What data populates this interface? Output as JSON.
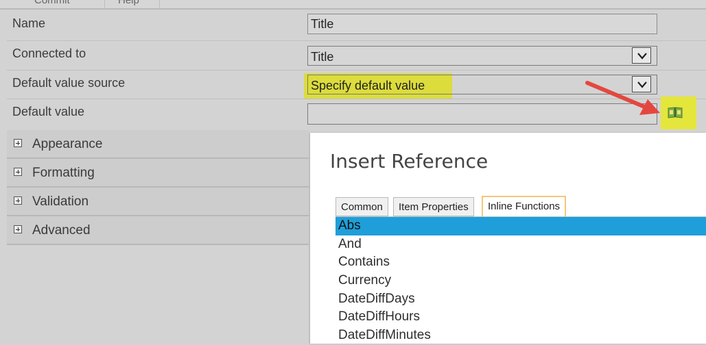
{
  "top_tabs": {
    "commit": "Commit",
    "help": "Help"
  },
  "properties": {
    "name_label": "Name",
    "name_value": "Title",
    "connected_label": "Connected to",
    "connected_value": "Title",
    "dvs_label": "Default value source",
    "dvs_value": "Specify default value",
    "dv_label": "Default value",
    "dv_value": ""
  },
  "sections": [
    "Appearance",
    "Formatting",
    "Validation",
    "Advanced"
  ],
  "dialog": {
    "title": "Insert Reference",
    "tabs": [
      "Common",
      "Item Properties",
      "Inline Functions"
    ],
    "active_tab": "Inline Functions",
    "items": [
      "Abs",
      "And",
      "Contains",
      "Currency",
      "DateDiffDays",
      "DateDiffHours",
      "DateDiffMinutes"
    ],
    "selected_item": "Abs"
  },
  "colors": {
    "highlight": "#dcdc3c",
    "selection": "#1e9fd9",
    "arrow": "#e4473f",
    "active_tab_border": "#f2c879"
  },
  "icons": {
    "dropdown": "chevron-down-icon",
    "reference": "book-icon",
    "expand": "plus-icon"
  }
}
